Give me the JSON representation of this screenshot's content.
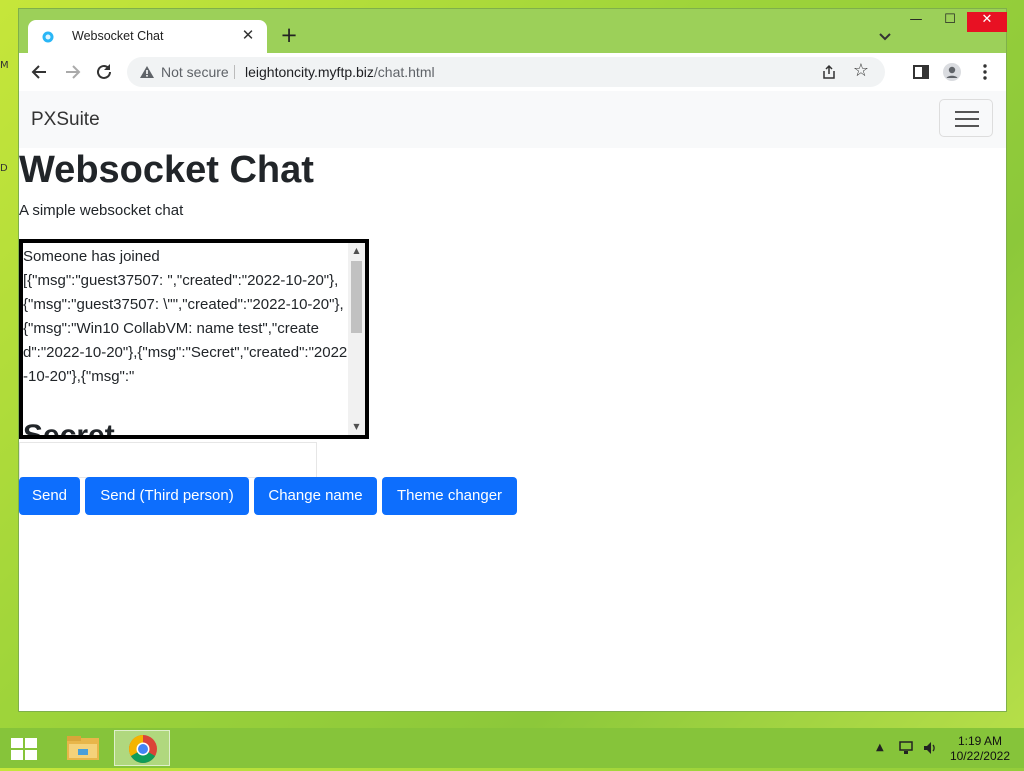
{
  "desktop": {
    "fragments": [
      "M",
      "D"
    ]
  },
  "browser": {
    "tab_title": "Websocket Chat",
    "tab_close": "✕",
    "new_tab": "+",
    "window_controls": {
      "minimize": "—",
      "maximize": "☐",
      "close": "✕"
    },
    "security_label": "Not secure",
    "url_host": "leightoncity.myftp.biz",
    "url_path": "/chat.html"
  },
  "page": {
    "brand": "PXSuite",
    "heading": "Websocket Chat",
    "lead": "A simple websocket chat",
    "chat": {
      "lines": "Someone has joined\n[{\"msg\":\"guest37507: \",\"created\":\"2022-10-20\"},{\"msg\":\"guest37507: \\\"\",\"created\":\"2022-10-20\"},{\"msg\":\"Win10 CollabVM: name test\",\"created\":\"2022-10-20\"},{\"msg\":\"Secret\",\"created\":\"2022-10-20\"},{\"msg\":\"",
      "big_text": "Secret"
    },
    "message_input_value": "",
    "buttons": {
      "send": "Send",
      "send_third": "Send (Third person)",
      "change_name": "Change name",
      "theme_changer": "Theme changer"
    }
  },
  "taskbar": {
    "time": "1:19 AM",
    "date": "10/22/2022"
  },
  "colors": {
    "primary_button": "#0d6efd",
    "desktop_green": "#9ed43a",
    "close_red": "#e81123"
  }
}
